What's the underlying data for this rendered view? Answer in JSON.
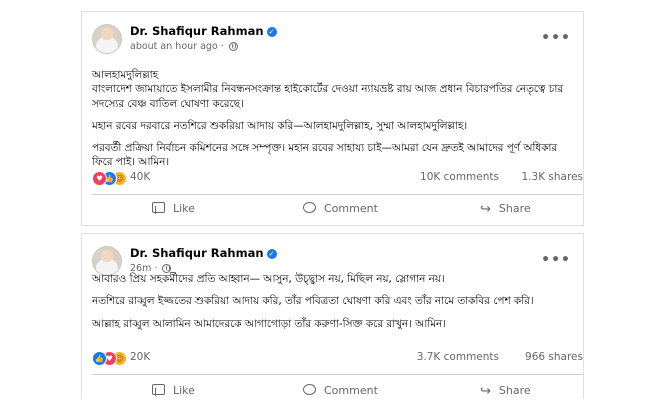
{
  "posts": [
    {
      "author": "Dr. Shafiqur Rahman",
      "time": "about an hour ago",
      "time_sep": "·",
      "more": "•••",
      "paragraphs": [
        "আলহামদুলিল্লাহ",
        "বাংলাদেশ জামায়াতে ইসলামীর নিবন্ধনসংক্রান্ত হাইকোর্টের দেওয়া ন্যায়ভ্রষ্ট রায় আজ প্রধান বিচারপতির নেতৃত্বে চার সদস্যের বেঞ্চ বাতিল ঘোষণা করেছে।",
        "মহান রবের দরবারে নতশিরে শুকরিয়া আদায় করি—আলহামদুলিল্লাহ, সুম্মা আলহামদুলিল্লাহ।",
        "পরবর্তী প্রক্রিয়া নির্বাচন কমিশনের সঙ্গে সম্পৃক্ত। মহান রবের সাহায্য চাই—আমরা যেন দ্রুতই আমাদের পূর্ণ অধিকার ফিরে পাই। আমিন।"
      ],
      "reactions_count": "40K",
      "comments": "10K comments",
      "shares": "1.3K shares"
    },
    {
      "author": "Dr. Shafiqur Rahman",
      "time": "26m",
      "time_sep": "·",
      "more": "•••",
      "paragraphs": [
        "আবারও প্রিয় সহকর্মীদের প্রতি আহ্বান— আসুন, উচ্ছ্বাস নয়, মিছিল নয়, স্লোগান নয়।",
        "নতশিরে রাব্বুল ইজ্জতের শুকরিয়া আদায় করি, তাঁর পবিত্রতা ঘোষণা করি এবং তাঁর নামে তাকবির পেশ করি।",
        "আল্লাহ রাব্বুল আলামিন আমাদেরকে আগাগোড়া তাঁর করুণা-সিক্ত করে রাখুন। আমিন।"
      ],
      "reactions_count": "20K",
      "comments": "3.7K comments",
      "shares": "966 shares"
    }
  ],
  "actions": {
    "like": "Like",
    "comment": "Comment",
    "share": "Share"
  },
  "icons": {
    "verified": "verified-badge-icon",
    "privacy": "globe-icon",
    "reaction_love": "love-reaction-icon",
    "reaction_like": "like-reaction-icon",
    "reaction_care": "care-reaction-icon"
  },
  "colors": {
    "accent": "#1877f2",
    "love": "#f33e58",
    "care": "#f7b125",
    "secondary_text": "#65676b"
  }
}
